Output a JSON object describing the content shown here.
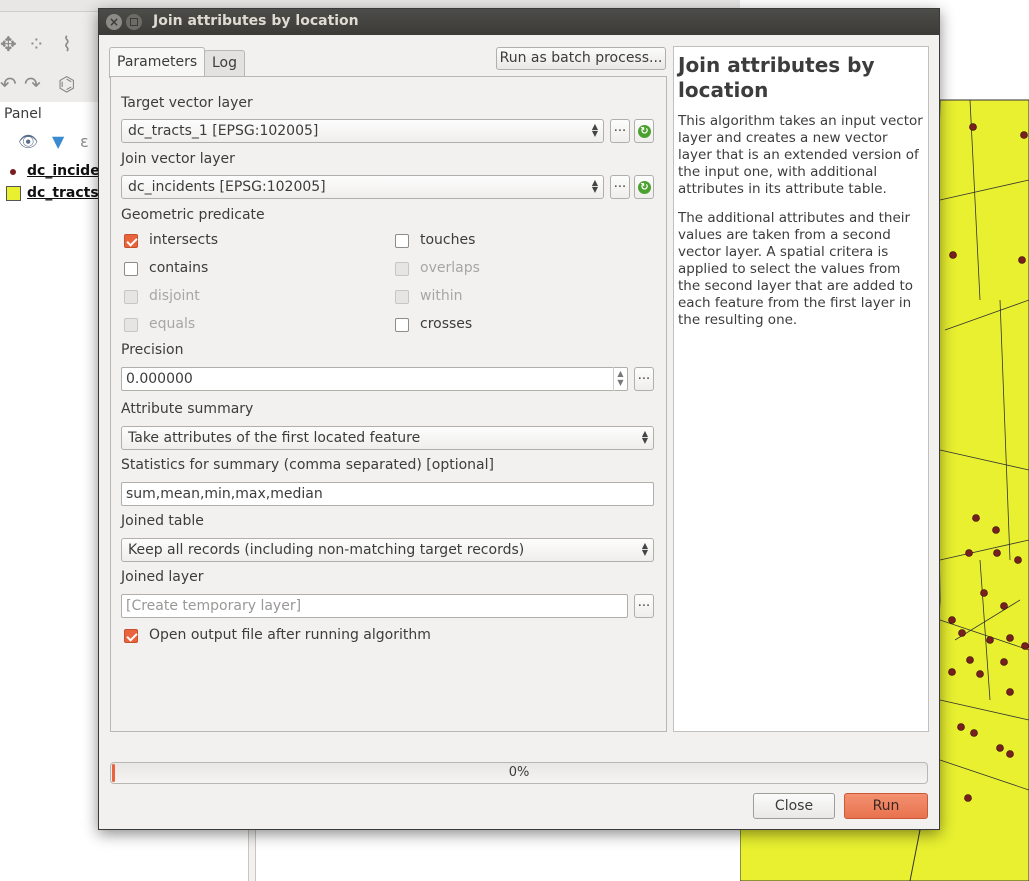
{
  "background": {
    "panel_header": "Panel",
    "layers": [
      {
        "name": "dc_incider",
        "type": "point"
      },
      {
        "name": "dc_tracts_",
        "type": "polygon"
      }
    ]
  },
  "dialog": {
    "title": "Join attributes by location",
    "tabs": [
      {
        "label": "Parameters",
        "active": true
      },
      {
        "label": "Log",
        "active": false
      }
    ],
    "batch_button": "Run as batch process...",
    "target_layer": {
      "label": "Target vector layer",
      "value": "dc_tracts_1 [EPSG:102005]"
    },
    "join_layer": {
      "label": "Join vector layer",
      "value": "dc_incidents [EPSG:102005]"
    },
    "ellipsis": "...",
    "predicate": {
      "label": "Geometric predicate",
      "options": [
        {
          "label": "intersects",
          "checked": true,
          "enabled": true
        },
        {
          "label": "touches",
          "checked": false,
          "enabled": true
        },
        {
          "label": "contains",
          "checked": false,
          "enabled": true
        },
        {
          "label": "overlaps",
          "checked": false,
          "enabled": false
        },
        {
          "label": "disjoint",
          "checked": false,
          "enabled": false
        },
        {
          "label": "within",
          "checked": false,
          "enabled": false
        },
        {
          "label": "equals",
          "checked": false,
          "enabled": false
        },
        {
          "label": "crosses",
          "checked": false,
          "enabled": true
        }
      ]
    },
    "precision": {
      "label": "Precision",
      "value": "0.000000"
    },
    "attribute_summary": {
      "label": "Attribute summary",
      "value": "Take attributes of the first located feature"
    },
    "statistics": {
      "label": "Statistics for summary (comma separated) [optional]",
      "value": "sum,mean,min,max,median"
    },
    "joined_table": {
      "label": "Joined table",
      "value": "Keep all records (including non-matching target records)"
    },
    "joined_layer": {
      "label": "Joined layer",
      "placeholder": "[Create temporary layer]"
    },
    "open_output": {
      "label": "Open output file after running algorithm",
      "checked": true
    },
    "help": {
      "title": "Join attributes by location",
      "paragraphs": [
        "This algorithm takes an input vector layer and creates a new vector layer that is an extended version of the input one, with additional attributes in its attribute table.",
        "The additional attributes and their values are taken from a second vector layer. A spatial critera is applied to select the values from the second layer that are added to each feature from the first layer in the resulting one."
      ]
    },
    "progress": {
      "text": "0%",
      "value": 0
    },
    "close_button": "Close",
    "run_button": "Run"
  },
  "colors": {
    "accent": "#e9633c",
    "map_polygon": "#e8f030",
    "map_point": "#7a1f1f"
  }
}
